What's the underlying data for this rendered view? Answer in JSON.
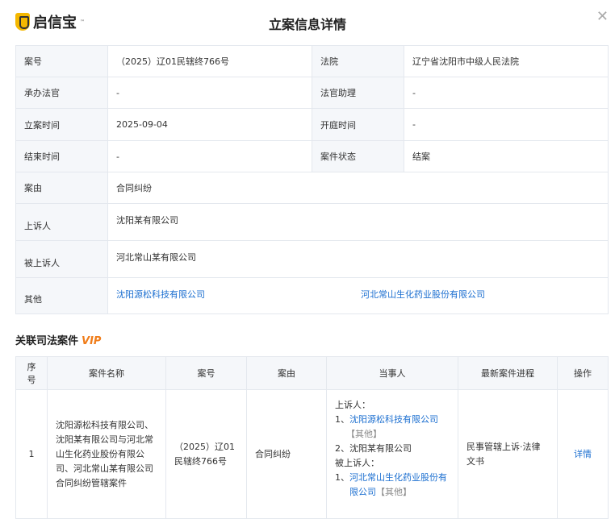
{
  "header": {
    "logo_text": "启信宝",
    "logo_tm": "™",
    "title": "立案信息详情",
    "close_icon": "close-icon"
  },
  "info": [
    {
      "l1": "案号",
      "v1": "（2025）辽01民辖终766号",
      "l2": "法院",
      "v2": "辽宁省沈阳市中级人民法院"
    },
    {
      "l1": "承办法官",
      "v1": "-",
      "l2": "法官助理",
      "v2": "-"
    },
    {
      "l1": "立案时间",
      "v1": "2025-09-04",
      "l2": "开庭时间",
      "v2": "-"
    },
    {
      "l1": "结束时间",
      "v1": "-",
      "l2": "案件状态",
      "v2": "结案"
    }
  ],
  "cause": {
    "label": "案由",
    "value": "合同纠纷"
  },
  "appellant": {
    "label": "上诉人",
    "value": "沈阳某有限公司"
  },
  "appellee": {
    "label": "被上诉人",
    "value": "河北常山某有限公司"
  },
  "other": {
    "label": "其他",
    "links": [
      "沈阳源松科技有限公司",
      "河北常山生化药业股份有限公司"
    ]
  },
  "related": {
    "title": "关联司法案件",
    "badge": "VIP",
    "headers": [
      "序号",
      "案件名称",
      "案号",
      "案由",
      "当事人",
      "最新案件进程",
      "操作"
    ],
    "rows": [
      {
        "no": "1",
        "name": "沈阳源松科技有限公司、沈阳某有限公司与河北常山生化药业股份有限公司、河北常山某有限公司合同纠纷管辖案件",
        "case_no": "（2025）辽01民辖终766号",
        "cause": "合同纠纷",
        "parties": {
          "appellant_label": "上诉人：",
          "p1_prefix": "1、",
          "p1": "沈阳源松科技有限公司",
          "p1_role": "【其他】",
          "p2": "2、沈阳某有限公司",
          "appellee_label": "被上诉人：",
          "p3_prefix": "1、",
          "p3": "河北常山生化药业股份有限公司",
          "p3_role": "【其他】"
        },
        "progress": "民事管辖上诉·法律文书",
        "action": "详情"
      }
    ]
  }
}
